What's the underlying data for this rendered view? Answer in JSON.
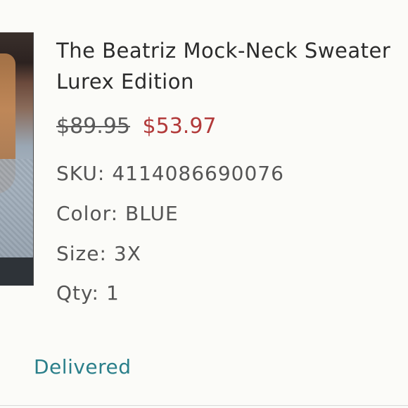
{
  "product": {
    "title_line1": "The Beatriz Mock-Neck Sweater",
    "title_line2": "Lurex Edition",
    "price_original": "$89.95",
    "price_sale": "$53.97",
    "sku_label": "SKU:",
    "sku_value": "4114086690076",
    "color_label": "Color:",
    "color_value": "BLUE",
    "size_label": "Size:",
    "size_value": "3X",
    "qty_label": "Qty:",
    "qty_value": "1"
  },
  "order": {
    "status": "Delivered",
    "status_color": "#2a7f8a"
  },
  "colors": {
    "sale_price": "#b23a3a",
    "text": "#555555",
    "title": "#2b2b2b"
  }
}
